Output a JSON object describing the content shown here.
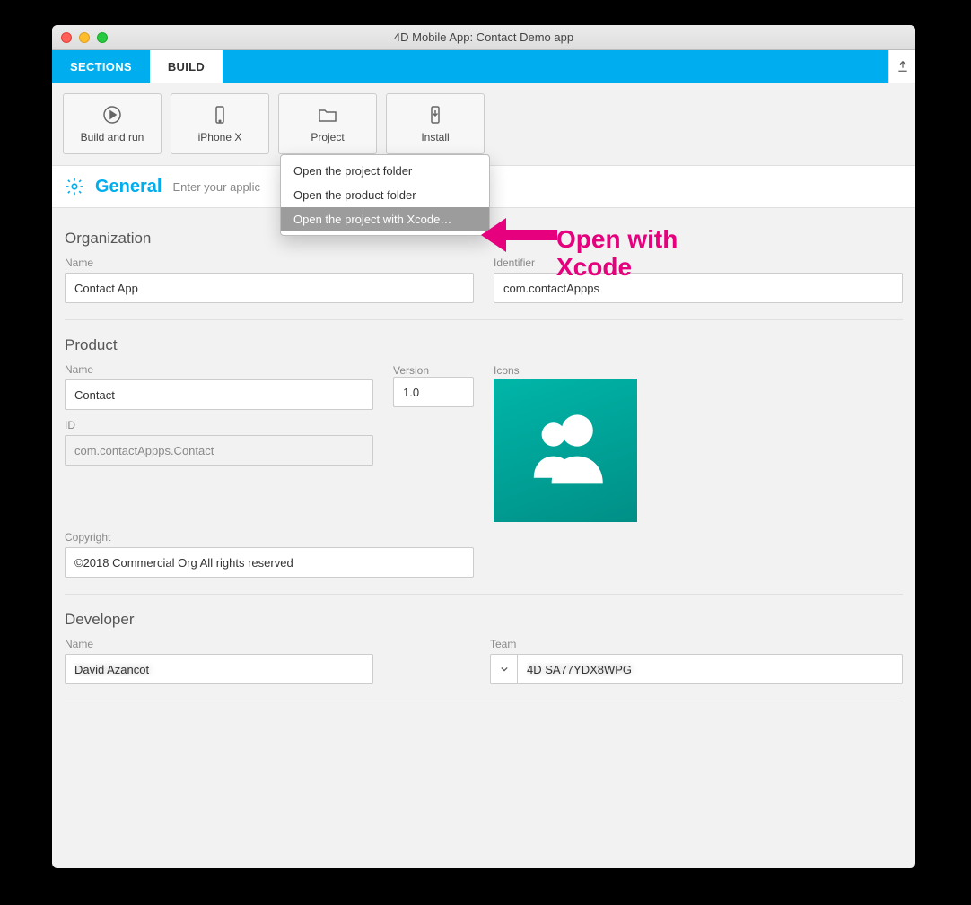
{
  "window": {
    "title": "4D Mobile App: Contact Demo app"
  },
  "tabs": {
    "sections": "SECTIONS",
    "build": "BUILD"
  },
  "toolbar": {
    "build_run": "Build and run",
    "device": "iPhone X",
    "project": "Project",
    "install": "Install"
  },
  "menu": {
    "open_folder": "Open the project folder",
    "open_product": "Open the product folder",
    "open_xcode": "Open the project with Xcode…"
  },
  "section": {
    "title": "General",
    "subtitle": "Enter your applic"
  },
  "organization": {
    "heading": "Organization",
    "name_label": "Name",
    "name_value": "Contact App",
    "identifier_label": "Identifier",
    "identifier_value": "com.contactAppps"
  },
  "product": {
    "heading": "Product",
    "name_label": "Name",
    "name_value": "Contact",
    "version_label": "Version",
    "version_value": "1.0",
    "icons_label": "Icons",
    "id_label": "ID",
    "id_value": "com.contactAppps.Contact",
    "copyright_label": "Copyright",
    "copyright_value": "©2018 Commercial Org All rights reserved"
  },
  "developer": {
    "heading": "Developer",
    "name_label": "Name",
    "name_value": "David Azancot",
    "team_label": "Team",
    "team_value": "4D SA77YDX8WPG"
  },
  "annotation": {
    "line1": "Open with",
    "line2": "Xcode"
  }
}
